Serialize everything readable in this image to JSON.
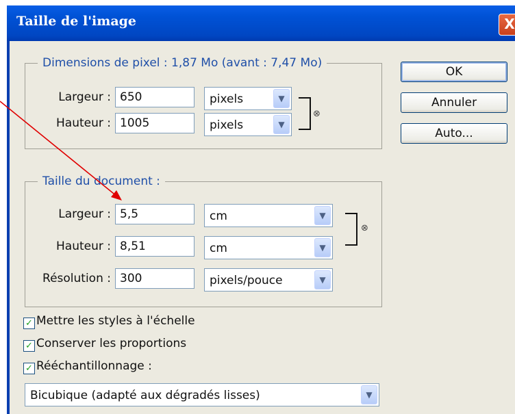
{
  "window": {
    "title": "Taille de l'image",
    "close_glyph": "X"
  },
  "pixel_dimensions": {
    "legend": "Dimensions de pixel :  1,87 Mo (avant : 7,47 Mo)",
    "width_label": "Largeur :",
    "width_value": "650",
    "width_unit": "pixels",
    "height_label": "Hauteur :",
    "height_value": "1005",
    "height_unit": "pixels"
  },
  "document_size": {
    "legend": "Taille du document :",
    "width_label": "Largeur :",
    "width_value": "5,5",
    "width_unit": "cm",
    "height_label": "Hauteur :",
    "height_value": "8,51",
    "height_unit": "cm",
    "resolution_label": "Résolution :",
    "resolution_value": "300",
    "resolution_unit": "pixels/pouce"
  },
  "buttons": {
    "ok": "OK",
    "cancel": "Annuler",
    "auto": "Auto..."
  },
  "options": {
    "scale_styles": "Mettre les styles à l'échelle",
    "constrain": "Conserver les proportions",
    "resample": "Rééchantillonnage :",
    "resample_method": "Bicubique (adapté aux dégradés lisses)"
  },
  "icons": {
    "dropdown": "chevron-down-icon",
    "link": "chain-link-icon",
    "check": "checkmark-icon"
  },
  "colors": {
    "titlebar": "#0052d6",
    "legend_text": "#1f4fa8",
    "annotation_arrow": "#e00000",
    "dialog_bg": "#eceae0"
  }
}
